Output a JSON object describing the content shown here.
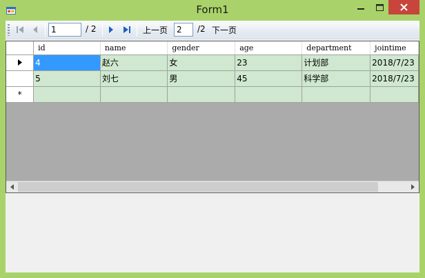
{
  "window": {
    "title": "Form1",
    "colors": {
      "frame": "#a9d36a",
      "close": "#c7453a",
      "grid_bg": "#ababab",
      "cell_bg": "#cfe8cf",
      "selected": "#3399ff"
    }
  },
  "toolbar": {
    "position_value": "1",
    "count_label": "/ 2",
    "prev_page_label": "上一页",
    "page_value": "2",
    "page_total_label": "/2",
    "next_page_label": "下一页",
    "icons": [
      "move-first-icon",
      "move-previous-icon",
      "move-next-icon",
      "move-last-icon"
    ]
  },
  "grid": {
    "columns": [
      "id",
      "name",
      "gender",
      "age",
      "department",
      "jointime"
    ],
    "rows": [
      [
        "4",
        "赵六",
        "女",
        "23",
        "计划部",
        "2018/7/23"
      ],
      [
        "5",
        "刘七",
        "男",
        "45",
        "科学部",
        "2018/7/23"
      ]
    ],
    "new_row_marker": "*",
    "current_row_icon": "current-row-arrow-icon"
  }
}
